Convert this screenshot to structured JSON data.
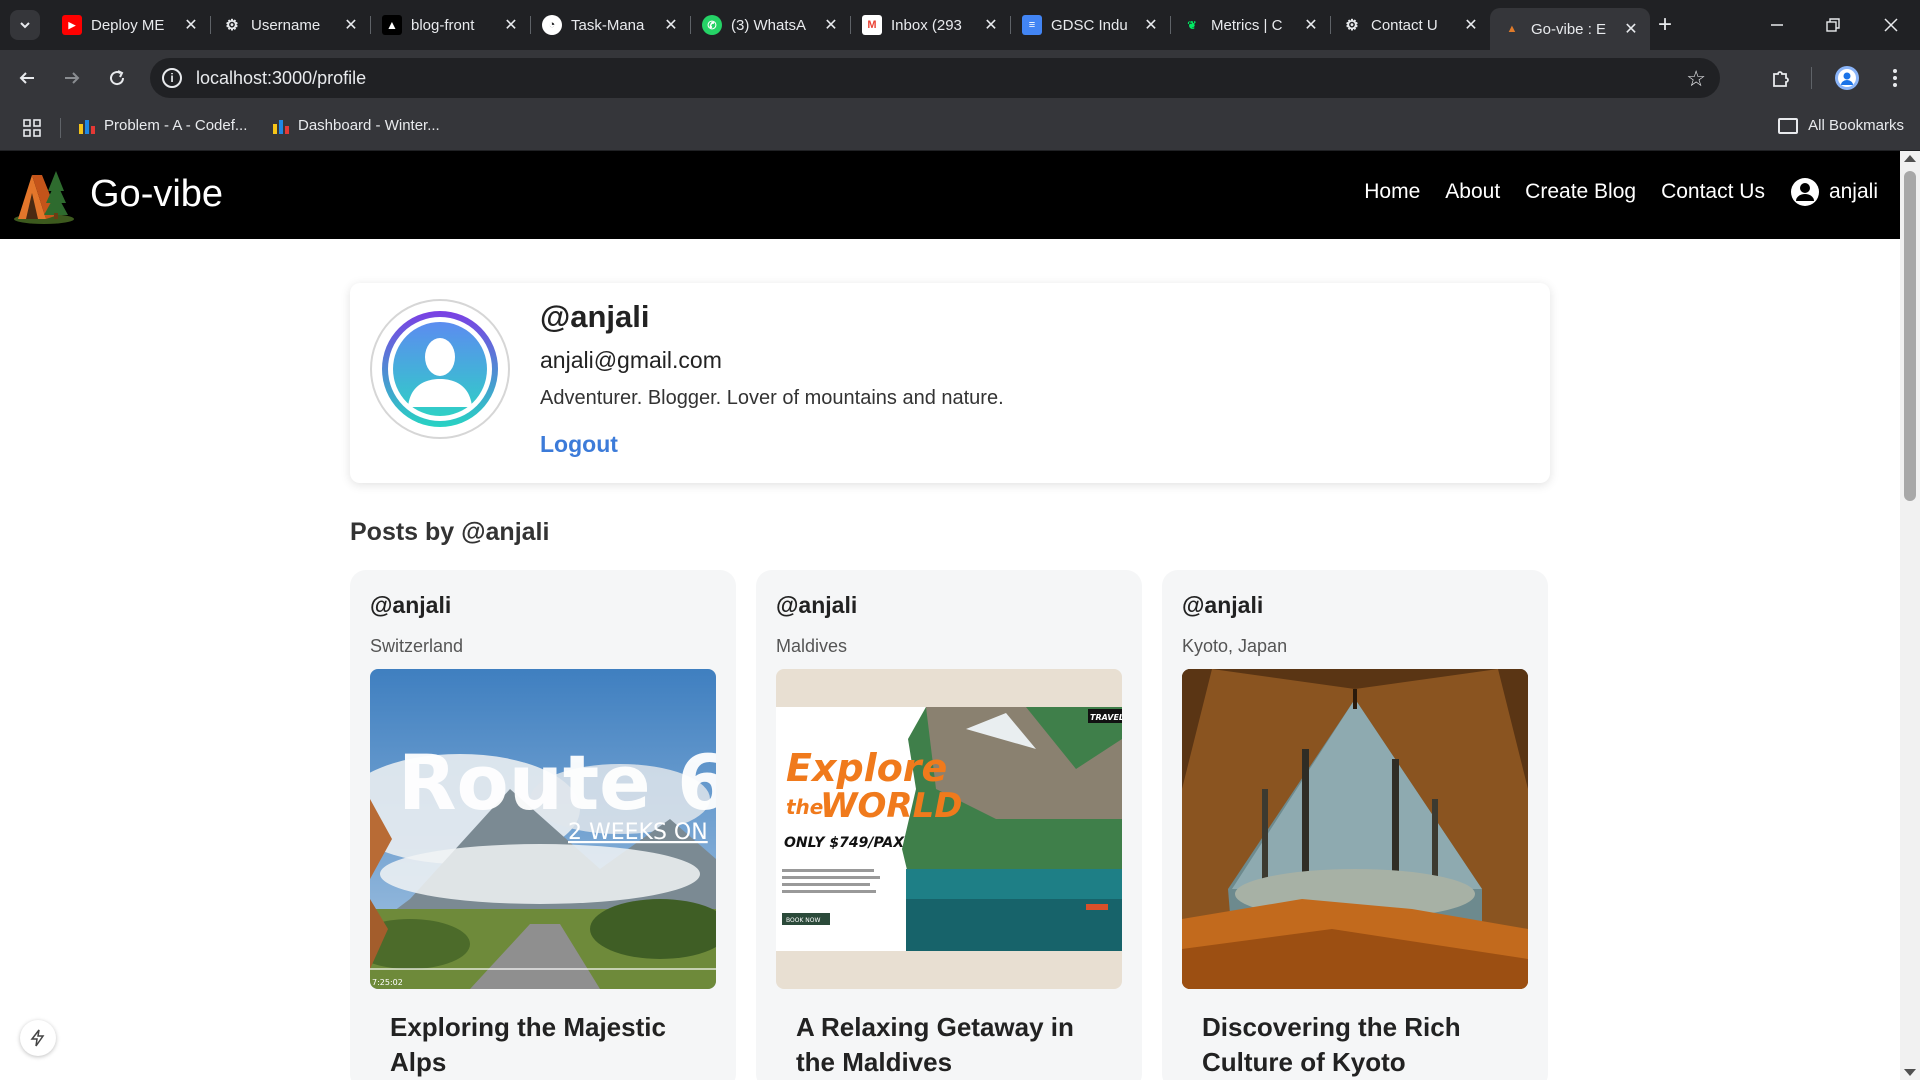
{
  "browser": {
    "tabs": [
      {
        "title": "Deploy ME",
        "favicon": "youtube-icon",
        "color": "#ff0000"
      },
      {
        "title": "Username",
        "favicon": "openai-icon",
        "color": "#202124"
      },
      {
        "title": "blog-front",
        "favicon": "vercel-icon",
        "color": "#000000"
      },
      {
        "title": "Task-Mana",
        "favicon": "render-icon",
        "color": "#ffffff"
      },
      {
        "title": "(3) WhatsA",
        "favicon": "whatsapp-icon",
        "color": "#25d366"
      },
      {
        "title": "Inbox (293",
        "favicon": "gmail-icon",
        "color": "#ea4335"
      },
      {
        "title": "GDSC Indu",
        "favicon": "docs-icon",
        "color": "#4285f4"
      },
      {
        "title": "Metrics | C",
        "favicon": "mongodb-icon",
        "color": "#00ed64"
      },
      {
        "title": "Contact U",
        "favicon": "openai-icon",
        "color": "#202124"
      },
      {
        "title": "Go-vibe : E",
        "favicon": "tent-icon",
        "color": "#e07b2a",
        "active": true
      }
    ],
    "url": "localhost:3000/profile",
    "bookmarks": [
      {
        "label": "Problem - A - Codef..."
      },
      {
        "label": "Dashboard - Winter..."
      }
    ],
    "all_bookmarks_label": "All Bookmarks"
  },
  "site": {
    "brand": "Go-vibe",
    "nav": {
      "home": "Home",
      "about": "About",
      "create_blog": "Create Blog",
      "contact": "Contact Us",
      "user": "anjali"
    }
  },
  "profile": {
    "handle": "@anjali",
    "email": "anjali@gmail.com",
    "bio": "Adventurer. Blogger. Lover of mountains and nature.",
    "logout": "Logout"
  },
  "posts_heading": "Posts by @anjali",
  "posts": [
    {
      "author": "@anjali",
      "location": "Switzerland",
      "title": "Exploring the Majestic Alps",
      "image_text": {
        "headline": "Route 6",
        "sub": "2 WEEKS ON",
        "timestamp": "7:25:02"
      }
    },
    {
      "author": "@anjali",
      "location": "Maldives",
      "title": "A Relaxing Getaway in the Maldives",
      "image_text": {
        "headline_1": "Explore",
        "headline_2": "the",
        "headline_3": "WORLD",
        "price": "ONLY $749/PAX",
        "tag": "TRAVEL",
        "button": "BOOK NOW"
      }
    },
    {
      "author": "@anjali",
      "location": "Kyoto, Japan",
      "title": "Discovering the Rich Culture of Kyoto"
    }
  ],
  "colors": {
    "nav_bg": "#000000",
    "link_blue": "#3c7bd9",
    "card_bg": "#f5f6f7"
  }
}
